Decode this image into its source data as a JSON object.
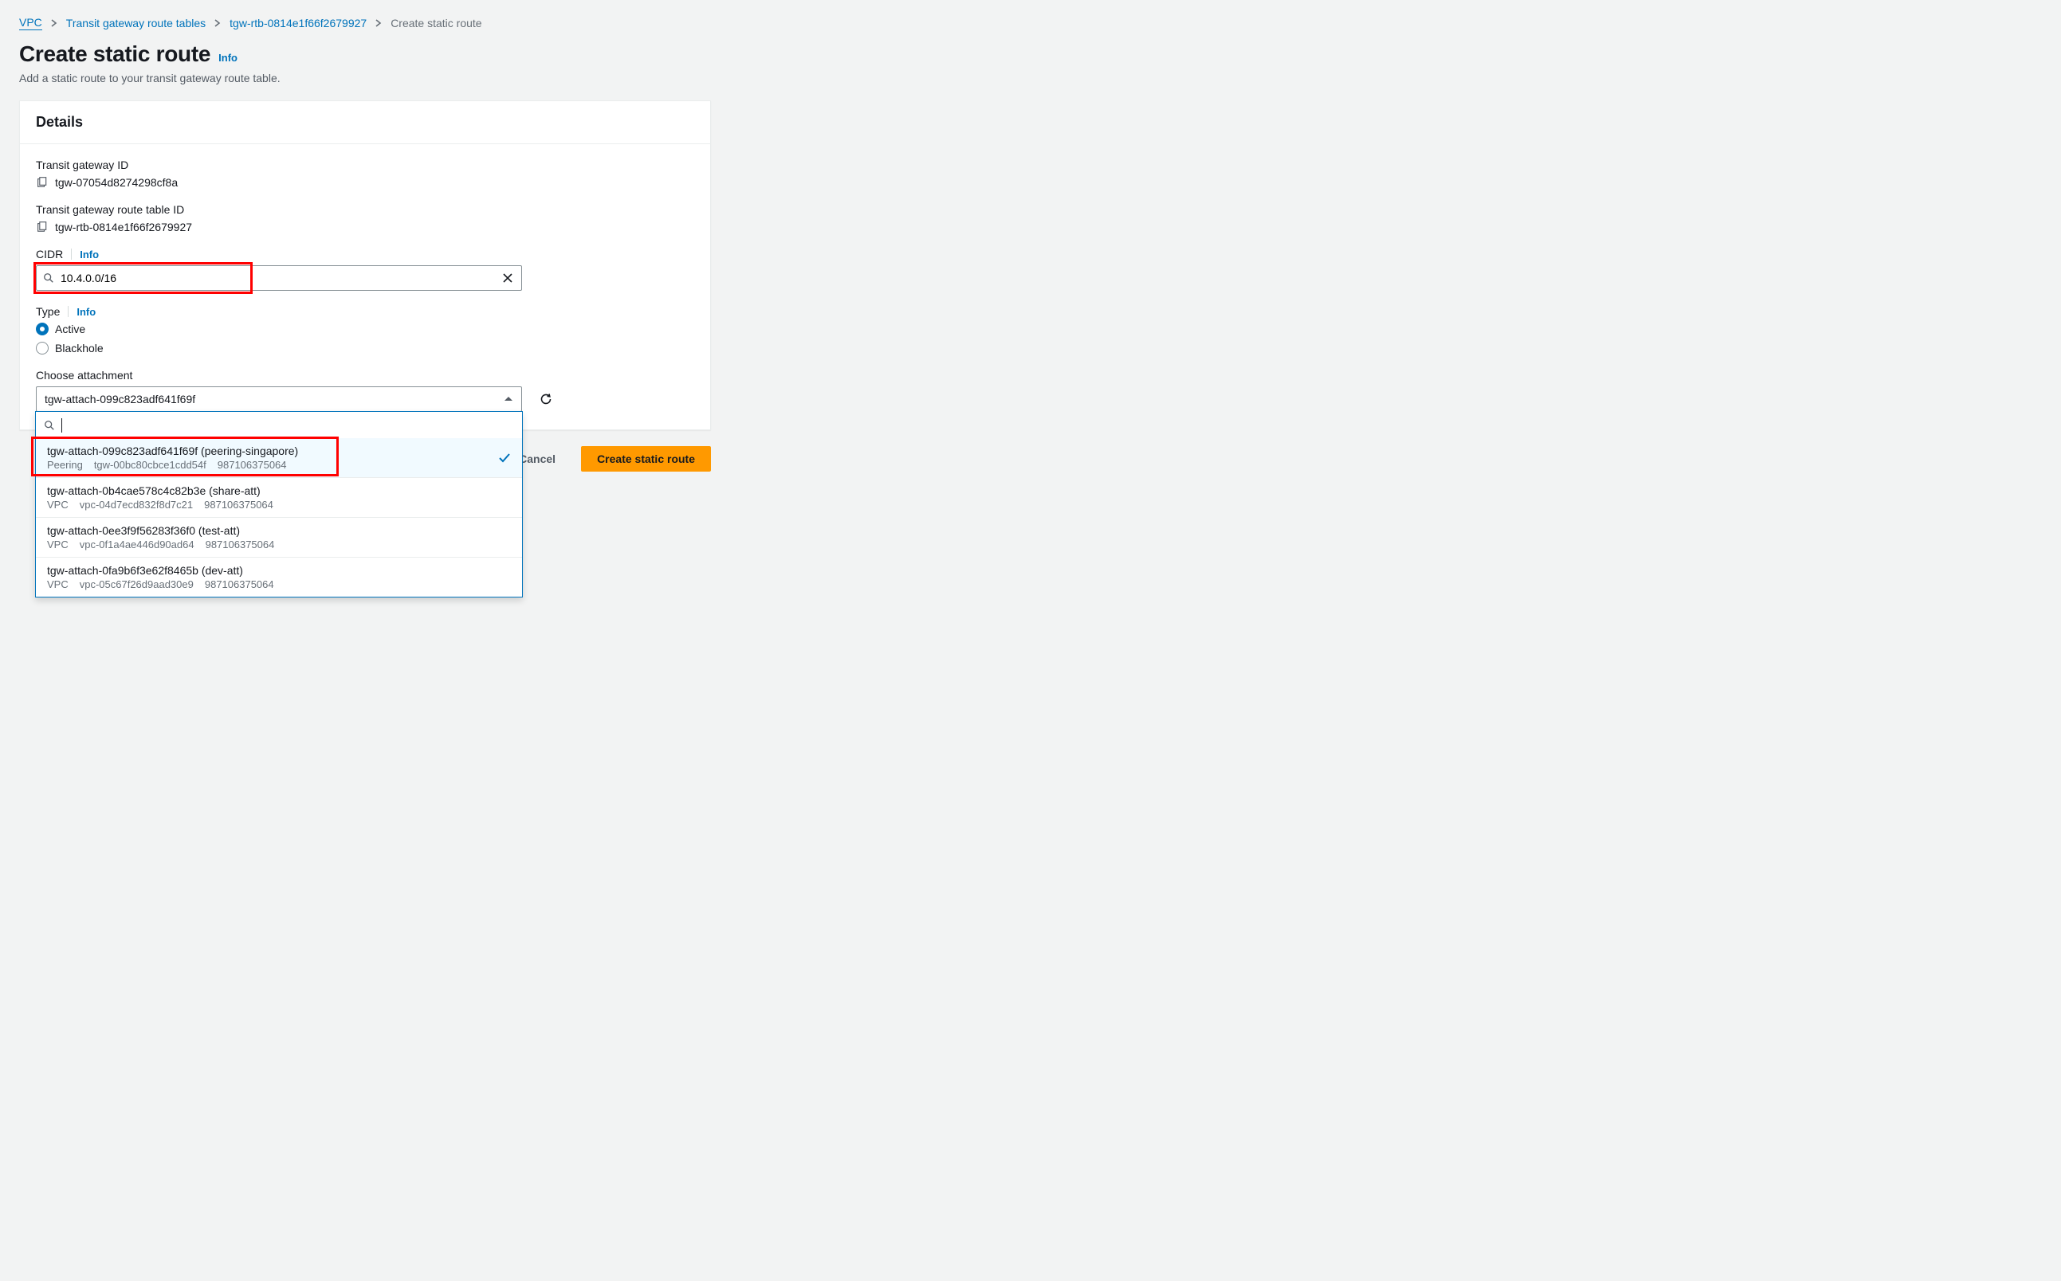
{
  "breadcrumb": {
    "items": [
      {
        "label": "VPC",
        "link": true,
        "underline": true
      },
      {
        "label": "Transit gateway route tables",
        "link": true
      },
      {
        "label": "tgw-rtb-0814e1f66f2679927",
        "link": true
      },
      {
        "label": "Create static route",
        "link": false
      }
    ]
  },
  "header": {
    "title": "Create static route",
    "info": "Info",
    "description": "Add a static route to your transit gateway route table."
  },
  "panel": {
    "title": "Details",
    "tgw_id_label": "Transit gateway ID",
    "tgw_id_value": "tgw-07054d8274298cf8a",
    "rtb_id_label": "Transit gateway route table ID",
    "rtb_id_value": "tgw-rtb-0814e1f66f2679927",
    "cidr_label": "CIDR",
    "cidr_info": "Info",
    "cidr_value": "10.4.0.0/16",
    "type_label": "Type",
    "type_info": "Info",
    "type_options": {
      "active": "Active",
      "blackhole": "Blackhole"
    },
    "attach_label": "Choose attachment",
    "attach_value": "tgw-attach-099c823adf641f69f"
  },
  "dropdown": {
    "items": [
      {
        "title": "tgw-attach-099c823adf641f69f (peering-singapore)",
        "type": "Peering",
        "resource": "tgw-00bc80cbce1cdd54f",
        "account": "987106375064",
        "selected": true
      },
      {
        "title": "tgw-attach-0b4cae578c4c82b3e (share-att)",
        "type": "VPC",
        "resource": "vpc-04d7ecd832f8d7c21",
        "account": "987106375064",
        "selected": false
      },
      {
        "title": "tgw-attach-0ee3f9f56283f36f0 (test-att)",
        "type": "VPC",
        "resource": "vpc-0f1a4ae446d90ad64",
        "account": "987106375064",
        "selected": false
      },
      {
        "title": "tgw-attach-0fa9b6f3e62f8465b (dev-att)",
        "type": "VPC",
        "resource": "vpc-05c67f26d9aad30e9",
        "account": "987106375064",
        "selected": false
      }
    ]
  },
  "footer": {
    "cancel": "Cancel",
    "submit": "Create static route"
  }
}
